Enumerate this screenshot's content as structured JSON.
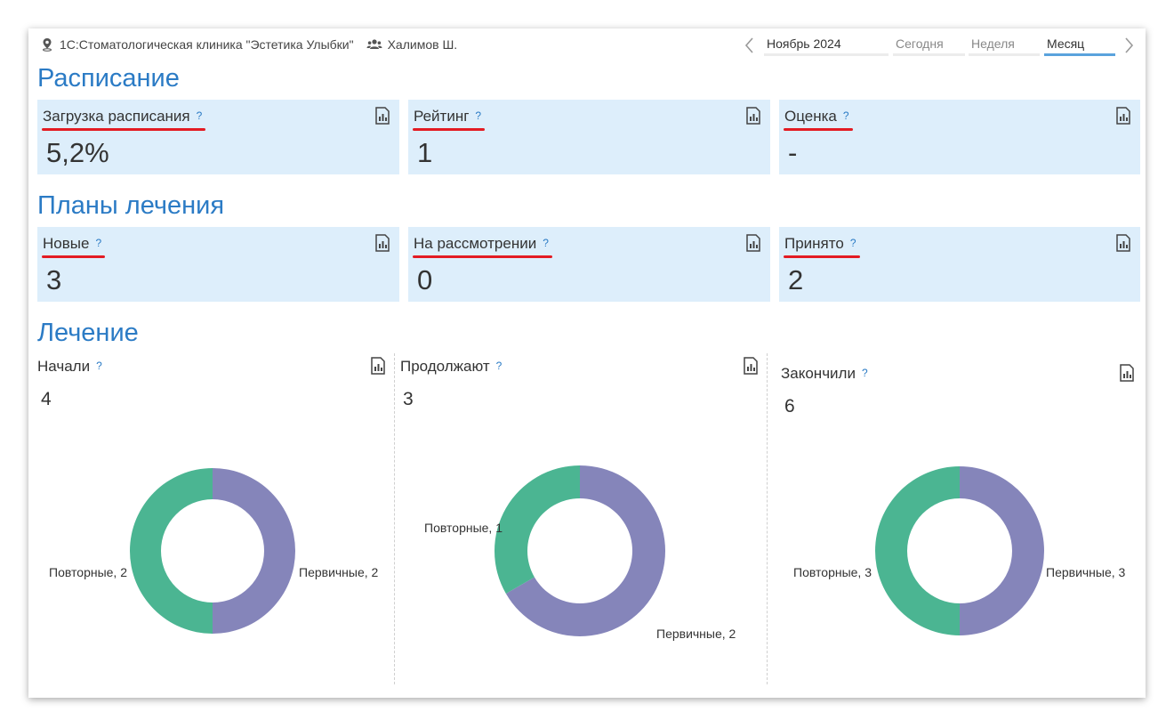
{
  "header": {
    "organization": "1С:Стоматологическая клиника \"Эстетика Улыбки\"",
    "user": "Халимов Ш.",
    "period_value": "Ноябрь 2024",
    "periods": [
      "Сегодня",
      "Неделя",
      "Месяц"
    ],
    "active_period": "Месяц"
  },
  "schedule": {
    "title": "Расписание",
    "tiles": [
      {
        "label": "Загрузка расписания",
        "value": "5,2%"
      },
      {
        "label": "Рейтинг",
        "value": "1"
      },
      {
        "label": "Оценка",
        "value": "-"
      }
    ]
  },
  "plans": {
    "title": "Планы лечения",
    "tiles": [
      {
        "label": "Новые",
        "value": "3"
      },
      {
        "label": "На рассмотрении",
        "value": "0"
      },
      {
        "label": "Принято",
        "value": "2"
      }
    ]
  },
  "treatment": {
    "title": "Лечение",
    "columns": [
      {
        "title": "Начали",
        "value": "4"
      },
      {
        "title": "Продолжают",
        "value": "3"
      },
      {
        "title": "Закончили",
        "value": "6"
      }
    ]
  },
  "help_mark": "?",
  "colors": {
    "accent": "#2b7bc5",
    "tile_bg": "#ddeefb",
    "underline": "#e31b23",
    "primary_slice": "#8585ba",
    "repeat_slice": "#4bb592"
  },
  "chart_data": [
    {
      "type": "pie",
      "title": "Начали",
      "categories": [
        "Первичные",
        "Повторные"
      ],
      "values": [
        2,
        2
      ],
      "labels": [
        "Первичные, 2",
        "Повторные, 2"
      ]
    },
    {
      "type": "pie",
      "title": "Продолжают",
      "categories": [
        "Первичные",
        "Повторные"
      ],
      "values": [
        2,
        1
      ],
      "labels": [
        "Первичные, 2",
        "Повторные, 1"
      ]
    },
    {
      "type": "pie",
      "title": "Закончили",
      "categories": [
        "Первичные",
        "Повторные"
      ],
      "values": [
        3,
        3
      ],
      "labels": [
        "Первичные, 3",
        "Повторные, 3"
      ]
    }
  ]
}
